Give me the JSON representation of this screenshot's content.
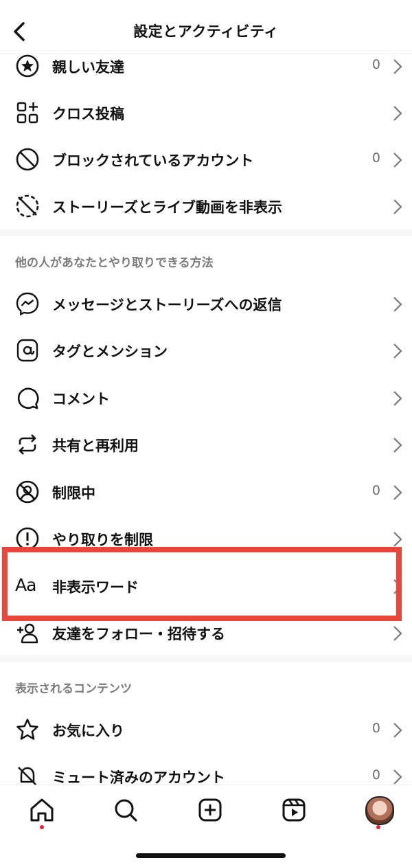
{
  "header": {
    "title": "設定とアクティビティ"
  },
  "rows_top": [
    {
      "label": "親しい友達",
      "count": "0",
      "icon": "star-circle-icon"
    },
    {
      "label": "クロス投稿",
      "count": "",
      "icon": "grid-apps-icon"
    },
    {
      "label": "ブロックされているアカウント",
      "count": "0",
      "icon": "block-icon"
    },
    {
      "label": "ストーリーズとライブ動画を非表示",
      "count": "",
      "icon": "hide-story-icon"
    }
  ],
  "section_interactions": {
    "title": "他の人があなたとやり取りできる方法",
    "rows": [
      {
        "label": "メッセージとストーリーズへの返信",
        "count": "",
        "icon": "messenger-icon"
      },
      {
        "label": "タグとメンション",
        "count": "",
        "icon": "at-sign-icon"
      },
      {
        "label": "コメント",
        "count": "",
        "icon": "comment-icon"
      },
      {
        "label": "共有と再利用",
        "count": "",
        "icon": "repost-icon"
      },
      {
        "label": "制限中",
        "count": "0",
        "icon": "restricted-icon"
      },
      {
        "label": "やり取りを制限",
        "count": "",
        "icon": "alert-circle-icon"
      },
      {
        "label": "非表示ワード",
        "count": "",
        "icon": "text-aa-icon",
        "icon_text": "Aa"
      },
      {
        "label": "友達をフォロー・招待する",
        "count": "",
        "icon": "add-person-icon"
      }
    ]
  },
  "section_content": {
    "title": "表示されるコンテンツ",
    "rows": [
      {
        "label": "お気に入り",
        "count": "0",
        "icon": "star-icon"
      },
      {
        "label": "ミュート済みのアカウント",
        "count": "0",
        "icon": "mute-bell-icon"
      }
    ]
  },
  "tabbar": {
    "items": [
      "home-icon",
      "search-icon",
      "create-icon",
      "reels-icon",
      "profile-avatar"
    ],
    "active": "home-icon"
  },
  "colors": {
    "highlight": "#e8473b",
    "notification_dot": "#e8213b"
  }
}
